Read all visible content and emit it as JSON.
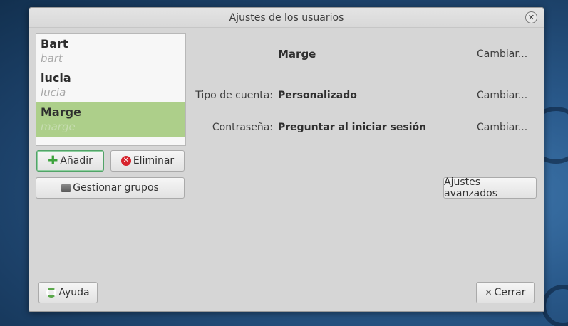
{
  "window": {
    "title": "Ajustes de los usuarios"
  },
  "users": [
    {
      "name": "Bart",
      "login": "bart",
      "selected": false
    },
    {
      "name": "lucia",
      "login": "lucia",
      "selected": false
    },
    {
      "name": "Marge",
      "login": "marge",
      "selected": true
    }
  ],
  "buttons": {
    "add": "Añadir",
    "remove": "Eliminar",
    "manage_groups": "Gestionar grupos",
    "advanced": "Ajustes avanzados",
    "help": "Ayuda",
    "close": "Cerrar"
  },
  "details": {
    "user_name": "Marge",
    "account_type_label": "Tipo de cuenta:",
    "account_type_value": "Personalizado",
    "password_label": "Contraseña:",
    "password_value": "Preguntar al iniciar sesión",
    "change_label": "Cambiar..."
  },
  "colors": {
    "selection": "#adcf8a",
    "window_bg": "#d6d6d6"
  }
}
